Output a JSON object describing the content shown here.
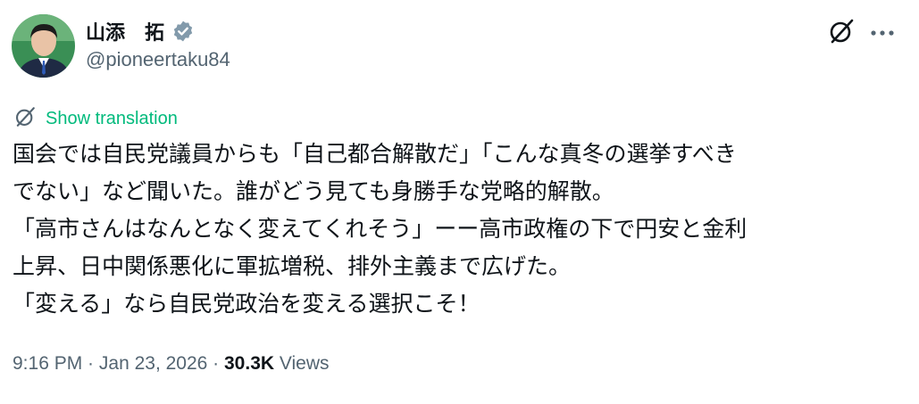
{
  "author": {
    "display_name": "山添　拓",
    "handle": "@pioneertaku84",
    "verified": true
  },
  "translate": {
    "label": "Show translation"
  },
  "body": {
    "lines": [
      "国会では自民党議員からも「自己都合解散だ」「こんな真冬の選挙すべき",
      "でない」など聞いた。誰がどう見ても身勝手な党略的解散。",
      "「高市さんはなんとなく変えてくれそう」ーー高市政権の下で円安と金利",
      "上昇、日中関係悪化に軍拡増税、排外主義まで広げた。",
      "「変える」なら自民党政治を変える選択こそ！"
    ]
  },
  "meta": {
    "time": "9:16 PM",
    "separator": " · ",
    "date": "Jan 23, 2026",
    "views_count": "30.3K",
    "views_label": " Views"
  },
  "icons": {
    "verified_badge": "verified-badge-icon",
    "grok": "grok-icon",
    "more": "more-dots-icon",
    "translate": "grok-translate-icon"
  },
  "colors": {
    "text_primary": "#0f1419",
    "text_secondary": "#536471",
    "translate_green": "#00ba7c",
    "avatar_bg": "#2f8a4a"
  }
}
